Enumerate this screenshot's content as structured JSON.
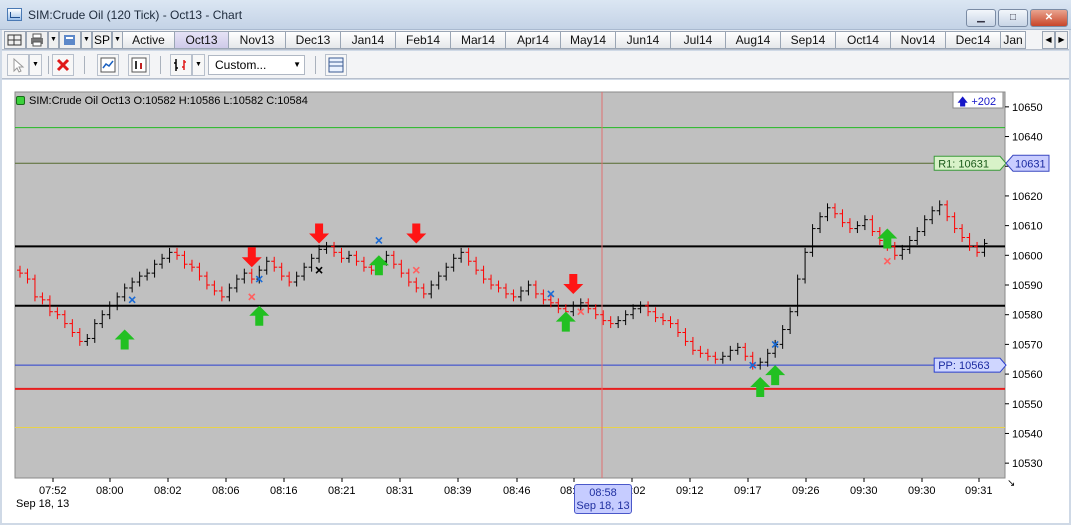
{
  "window": {
    "title": "SIM:Crude Oil (120 Tick) - Oct13 - Chart",
    "minimize": "▁",
    "maximize": "□",
    "close": "✕"
  },
  "instrument_selector": "SP",
  "tabs": [
    "Active",
    "Oct13",
    "Nov13",
    "Dec13",
    "Jan14",
    "Feb14",
    "Mar14",
    "Apr14",
    "May14",
    "Jun14",
    "Jul14",
    "Aug14",
    "Sep14",
    "Oct14",
    "Nov14",
    "Dec14",
    "Jan"
  ],
  "active_tab": "Oct13",
  "toolbar": {
    "template_select": "Custom..."
  },
  "chart_info": "SIM:Crude Oil Oct13 O:10582 H:10586 L:10582 C:10584",
  "position": {
    "arrow": "🡅",
    "value": "+202"
  },
  "date_label": "Sep 18, 13",
  "cursor_time": {
    "time": "08:58",
    "date": "Sep 18, 13"
  },
  "colors": {
    "chart_bg": "#c0c0c0",
    "up_bar": "#000000",
    "down_bar": "#ff0000",
    "long_arrow": "#22c022",
    "short_arrow": "#ff1515"
  },
  "chart_data": {
    "type": "ohlc",
    "y_axis": {
      "ticks": [
        10650,
        10640,
        10630,
        10620,
        10610,
        10600,
        10590,
        10580,
        10570,
        10560,
        10550,
        10540,
        10530
      ],
      "range": [
        10525,
        10655
      ]
    },
    "x_axis": {
      "tick_labels": [
        "07:52",
        "08:00",
        "08:02",
        "08:06",
        "08:16",
        "08:21",
        "08:31",
        "08:39",
        "08:46",
        "08:52",
        "09:02",
        "09:12",
        "09:17",
        "09:26",
        "09:30",
        "09:30",
        "09:31"
      ]
    },
    "levels": [
      {
        "value": 10643,
        "color": "#22b922"
      },
      {
        "value": 10631,
        "color": "#556b2f",
        "label": "R1: 10631",
        "axis_label": "10631"
      },
      {
        "value": 10603,
        "color": "#000000"
      },
      {
        "value": 10583,
        "color": "#000000"
      },
      {
        "value": 10563,
        "color": "#2a3fd0",
        "label": "PP: 10563"
      },
      {
        "value": 10555,
        "color": "#e81e1e"
      },
      {
        "value": 10542,
        "color": "#e8d24a"
      }
    ],
    "closes": [
      10594,
      10592,
      10586,
      10585,
      10581,
      10580,
      10577,
      10574,
      10571,
      10572,
      10577,
      10580,
      10583,
      10586,
      10589,
      10591,
      10593,
      10594,
      10597,
      10599,
      10601,
      10600,
      10597,
      10596,
      10593,
      10590,
      10588,
      10586,
      10589,
      10592,
      10594,
      10592,
      10595,
      10598,
      10596,
      10593,
      10591,
      10593,
      10596,
      10599,
      10602,
      10603,
      10601,
      10599,
      10600,
      10598,
      10596,
      10595,
      10598,
      10600,
      10597,
      10594,
      10591,
      10589,
      10587,
      10590,
      10593,
      10596,
      10599,
      10601,
      10598,
      10595,
      10592,
      10590,
      10589,
      10587,
      10586,
      10588,
      10590,
      10587,
      10585,
      10584,
      10582,
      10581,
      10583,
      10584,
      10582,
      10580,
      10578,
      10577,
      10578,
      10580,
      10582,
      10583,
      10581,
      10579,
      10578,
      10577,
      10574,
      10571,
      10568,
      10567,
      10566,
      10565,
      10566,
      10568,
      10569,
      10566,
      10563,
      10564,
      10567,
      10570,
      10575,
      10581,
      10592,
      10601,
      10609,
      10613,
      10616,
      10614,
      10611,
      10609,
      10610,
      10612,
      10608,
      10605,
      10603,
      10600,
      10602,
      10605,
      10608,
      10612,
      10615,
      10617,
      10613,
      10609,
      10606,
      10603,
      10601,
      10604
    ],
    "signals": [
      {
        "type": "long",
        "bar": 14,
        "price": 10572
      },
      {
        "type": "short",
        "bar": 31,
        "price": 10599
      },
      {
        "type": "long",
        "bar": 32,
        "price": 10580
      },
      {
        "type": "short",
        "bar": 40,
        "price": 10607
      },
      {
        "type": "long",
        "bar": 48,
        "price": 10597
      },
      {
        "type": "short",
        "bar": 53,
        "price": 10607
      },
      {
        "type": "short",
        "bar": 74,
        "price": 10590
      },
      {
        "type": "long",
        "bar": 73,
        "price": 10578
      },
      {
        "type": "long",
        "bar": 99,
        "price": 10556
      },
      {
        "type": "long",
        "bar": 101,
        "price": 10560
      },
      {
        "type": "long",
        "bar": 116,
        "price": 10606
      }
    ],
    "exits": [
      {
        "bar": 15,
        "price": 10585,
        "color": "#1a6bd6"
      },
      {
        "bar": 31,
        "price": 10586,
        "color": "#ff6060"
      },
      {
        "bar": 32,
        "price": 10592,
        "color": "#1a6bd6"
      },
      {
        "bar": 40,
        "price": 10595,
        "color": "#000000"
      },
      {
        "bar": 48,
        "price": 10605,
        "color": "#1a6bd6"
      },
      {
        "bar": 53,
        "price": 10595,
        "color": "#ff6060"
      },
      {
        "bar": 71,
        "price": 10587,
        "color": "#1a6bd6"
      },
      {
        "bar": 75,
        "price": 10581,
        "color": "#ff6060"
      },
      {
        "bar": 98,
        "price": 10563,
        "color": "#1a6bd6"
      },
      {
        "bar": 101,
        "price": 10570,
        "color": "#1a6bd6"
      },
      {
        "bar": 116,
        "price": 10598,
        "color": "#ff6060"
      }
    ]
  }
}
